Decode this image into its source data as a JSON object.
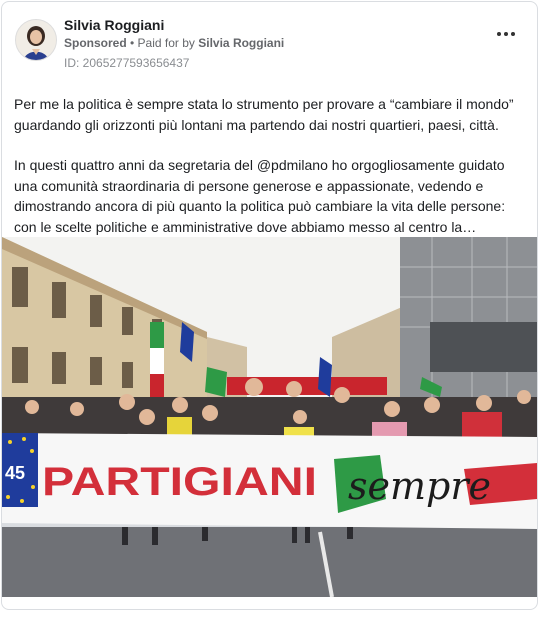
{
  "post": {
    "author_name": "Silvia Roggiani",
    "sponsored_label": "Sponsored",
    "separator": " • ",
    "paid_for_prefix": "Paid for by ",
    "paid_for_name": "Silvia Roggiani",
    "id_label": "ID: 2065277593656437",
    "more_icon": "more-horizontal-icon",
    "paragraphs": [
      "Per me la politica è sempre stata lo strumento per provare a “cambiare il mondo” guardando gli orizzonti più lontani ma partendo dai nostri quartieri, paesi, città.",
      "In questi quattro anni da segretaria del @pdmilano ho orgogliosamente guidato una comunità straordinaria di persone generose e appassionate, vedendo e dimostrando ancora di più quanto la politica può cambiare la vita delle persone: con le scelte politiche e amministrative dove abbiamo messo al centro la…"
    ],
    "image": {
      "banner_number": "45",
      "banner_main": "PARTIGIANI",
      "banner_script": "sempre"
    }
  },
  "colors": {
    "banner_red": "#d32f3a",
    "banner_green": "#2e9a46",
    "eu_blue": "#1f3c9c",
    "eu_star": "#f5d22a"
  }
}
